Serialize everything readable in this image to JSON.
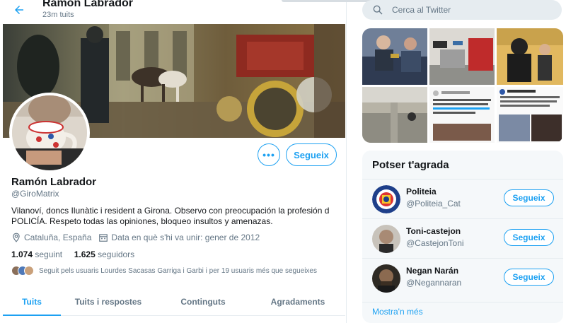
{
  "header": {
    "name": "Ramón Labrador",
    "tweet_count": "23m tuits"
  },
  "profile": {
    "name": "Ramón Labrador",
    "handle": "@GiroMatrix",
    "bio_line1": "Vilanoví, doncs Ilunàtic i resident a Girona. Observo con preocupación la profesión d",
    "bio_line2": "POLICÍA. Respeto todas las opiniones, bloqueo insultos y amenazas.",
    "location": "Cataluña, España",
    "joined": "Data en què s'hi va unir: gener de 2012",
    "following_count": "1.074",
    "following_label": "seguint",
    "followers_count": "1.625",
    "followers_label": "seguidors",
    "followed_by": "Seguit pels usuaris Lourdes Sacasas Garriga i Garbi i per 19 usuaris més que segueixes",
    "more_label": "•••",
    "follow_label": "Segueix"
  },
  "tabs": [
    {
      "label": "Tuits",
      "active": true
    },
    {
      "label": "Tuits i respostes",
      "active": false
    },
    {
      "label": "Continguts",
      "active": false
    },
    {
      "label": "Agradaments",
      "active": false
    }
  ],
  "search": {
    "placeholder": "Cerca al Twitter"
  },
  "who_to_follow": {
    "title": "Potser t'agrada",
    "items": [
      {
        "name": "Politeia",
        "handle": "@Politeia_Cat",
        "button": "Segueix"
      },
      {
        "name": "Toni-castejon",
        "handle": "@CastejonToni",
        "button": "Segueix"
      },
      {
        "name": "Negan Narán",
        "handle": "@Negannaran",
        "button": "Segueix"
      }
    ],
    "more": "Mostra'n més"
  },
  "colors": {
    "accent": "#1da1f2",
    "secondary_text": "#657786",
    "panel_bg": "#f5f8fa"
  }
}
